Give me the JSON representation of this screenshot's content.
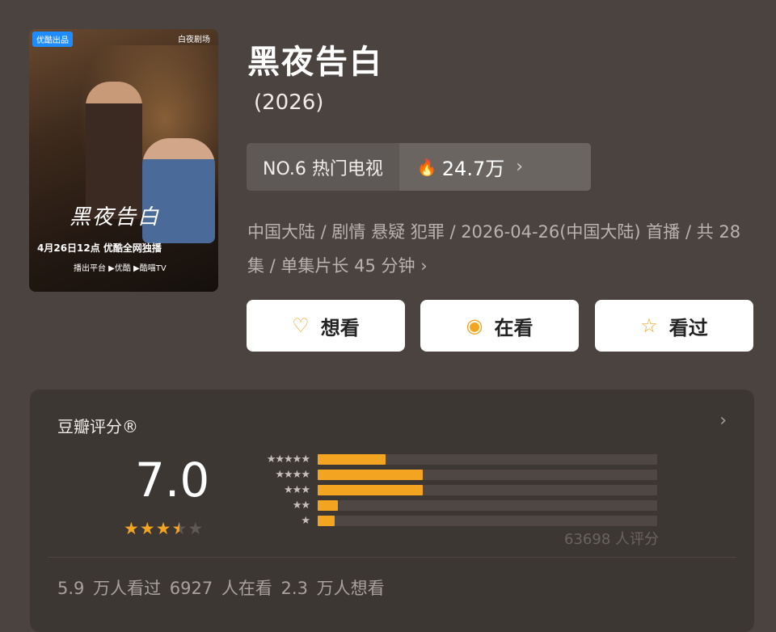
{
  "poster": {
    "badge": "优酷出品",
    "studio": "白夜剧场",
    "title_art": "黑夜告白",
    "release_banner": "4月26日12点 优酷全网独播",
    "platforms": "播出平台 ▶优酷 ▶酷喵TV"
  },
  "title": "黑夜告白",
  "year": "(2026)",
  "ranking": {
    "rank": "NO.6 热门电视",
    "heat": "24.7万"
  },
  "meta_text": "中国大陆 / 剧情 悬疑 犯罪 / 2026-04-26(中国大陆) 首播 / 共 28 集 / 单集片长 45 分钟",
  "buttons": {
    "want": "想看",
    "watching": "在看",
    "watched": "看过"
  },
  "rating": {
    "label": "豆瓣评分®",
    "score": "7.0",
    "stars_value": 3.5,
    "count": "63698 人评分",
    "distribution": [
      {
        "stars": "★★★★★",
        "fraction": 0.2
      },
      {
        "stars": "★★★★",
        "fraction": 0.31
      },
      {
        "stars": "★★★",
        "fraction": 0.31
      },
      {
        "stars": "★★",
        "fraction": 0.06
      },
      {
        "stars": "★",
        "fraction": 0.05
      }
    ]
  },
  "footer_stats": "5.9 万人看过   6927 人在看   2.3 万人想看",
  "colors": {
    "background": "#4a4340",
    "accent": "#f3a521",
    "card": "#3d3734"
  }
}
